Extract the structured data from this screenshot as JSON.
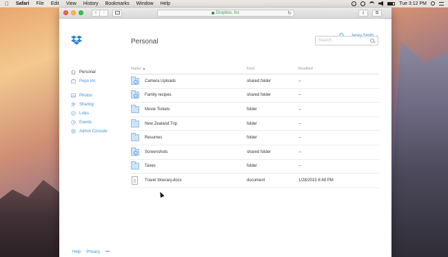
{
  "menubar": {
    "app": "Safari",
    "items": [
      "File",
      "Edit",
      "View",
      "History",
      "Bookmarks",
      "Window",
      "Help"
    ],
    "clock": "Tue 3:12 PM"
  },
  "browser": {
    "url": "Dropbox, Inc"
  },
  "header": {
    "title": "Personal",
    "user": "Janey Smith",
    "search_placeholder": "Search"
  },
  "sidebar": {
    "top": [
      {
        "label": "Personal",
        "icon": "home-icon"
      },
      {
        "label": "Pepo Inc",
        "icon": "briefcase-icon"
      }
    ],
    "bottom": [
      {
        "label": "Photos",
        "icon": "photo-icon"
      },
      {
        "label": "Sharing",
        "icon": "sharing-icon"
      },
      {
        "label": "Links",
        "icon": "link-icon"
      },
      {
        "label": "Events",
        "icon": "clock-icon"
      },
      {
        "label": "Admin Console",
        "icon": "gear-icon"
      }
    ]
  },
  "table": {
    "headers": {
      "name": "Name ▲",
      "kind": "Kind",
      "modified": "Modified"
    },
    "rows": [
      {
        "name": "Camera Uploads",
        "kind": "shared folder",
        "modified": "--",
        "type": "shared"
      },
      {
        "name": "Family recipes",
        "kind": "shared folder",
        "modified": "--",
        "type": "shared"
      },
      {
        "name": "Movie Tickets",
        "kind": "folder",
        "modified": "--",
        "type": "folder"
      },
      {
        "name": "New Zealand Trip",
        "kind": "folder",
        "modified": "--",
        "type": "folder"
      },
      {
        "name": "Resumes",
        "kind": "folder",
        "modified": "--",
        "type": "folder"
      },
      {
        "name": "Screenshots",
        "kind": "shared folder",
        "modified": "--",
        "type": "shared"
      },
      {
        "name": "Taxes",
        "kind": "folder",
        "modified": "--",
        "type": "folder"
      },
      {
        "name": "Travel Itinerary.docx",
        "kind": "document",
        "modified": "1/28/2015 6:48 PM",
        "type": "doc"
      }
    ]
  },
  "footer": {
    "help": "Help",
    "privacy": "Privacy",
    "more": "•••"
  },
  "colors": {
    "accent": "#3d8fd6",
    "secure": "#2a9d3f"
  }
}
